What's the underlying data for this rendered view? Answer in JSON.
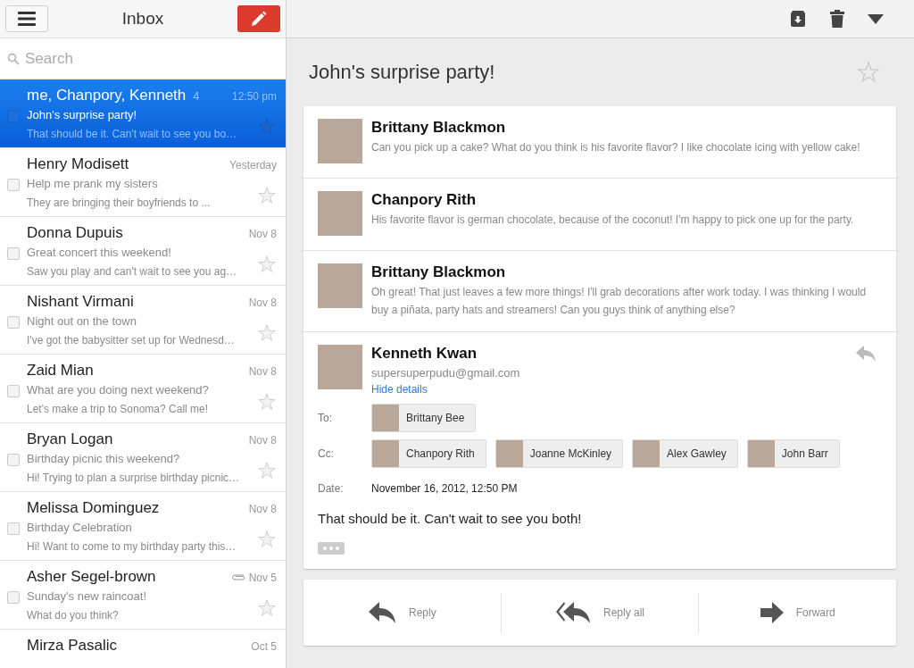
{
  "sidebar": {
    "title": "Inbox",
    "search": {
      "placeholder": "Search"
    },
    "threads": [
      {
        "sender": "me, Chanpory, Kenneth",
        "count": "4",
        "time": "12:50 pm",
        "subject": "John's surprise party!",
        "snippet": "That should be it. Can't wait to see you bo…",
        "selected": true,
        "checked": false,
        "starred": false,
        "attachment": false
      },
      {
        "sender": "Henry Modisett",
        "time": "Yesterday",
        "subject": "Help me prank my sisters",
        "snippet": "They are bringing their boyfriends to ...",
        "selected": false,
        "checked": false,
        "starred": false,
        "attachment": false
      },
      {
        "sender": "Donna Dupuis",
        "time": "Nov 8",
        "subject": "Great concert this weekend!",
        "snippet": "Saw you play and can't wait to see you ag…",
        "selected": false,
        "checked": false,
        "starred": false,
        "attachment": false
      },
      {
        "sender": "Nishant Virmani",
        "time": "Nov 8",
        "subject": "Night out on the town",
        "snippet": "I've got the babysitter set up for Wednesd…",
        "selected": false,
        "checked": false,
        "starred": false,
        "attachment": false
      },
      {
        "sender": "Zaid Mian",
        "time": "Nov 8",
        "subject": "What are you doing next weekend?",
        "snippet": "Let's make a trip to Sonoma? Call me!",
        "selected": false,
        "checked": false,
        "starred": false,
        "attachment": false
      },
      {
        "sender": "Bryan Logan",
        "time": "Nov 8",
        "subject": "Birthday picnic this weekend?",
        "snippet": "Hi! Trying to plan a surprise birthday picnic…",
        "selected": false,
        "checked": false,
        "starred": false,
        "attachment": false
      },
      {
        "sender": "Melissa Dominguez",
        "time": "Nov 8",
        "subject": "Birthday Celebration",
        "snippet": "Hi! Want to come to my birthday party this…",
        "selected": false,
        "checked": false,
        "starred": false,
        "attachment": false
      },
      {
        "sender": "Asher Segel-brown",
        "time": "Nov 5",
        "subject": "Sunday's new raincoat!",
        "snippet": "What do you think?",
        "selected": false,
        "checked": false,
        "starred": false,
        "attachment": true
      },
      {
        "sender": "Mirza Pasalic",
        "time": "Oct 5",
        "selected": false
      }
    ]
  },
  "conversation": {
    "subject": "John's surprise party!",
    "starred": false,
    "messages": [
      {
        "sender": "Brittany Blackmon",
        "snippet": "Can you pick up a cake? What do you think is his favorite flavor? I like chocolate icing with yellow cake!",
        "kind": "collapsed"
      },
      {
        "sender": "Chanpory Rith",
        "snippet": "His favorite flavor is german chocolate, because of the coconut! I'm happy to pick one up for the party.",
        "kind": "collapsed"
      },
      {
        "sender": "Brittany Blackmon",
        "snippet": "Oh great! That just leaves a few more things! I'll grab decorations after work today. I was thinking I would buy a piñata, party hats and streamers! Can you guys think of anything else?",
        "kind": "collapsed"
      },
      {
        "sender": "Kenneth Kwan",
        "email": "supersuperpudu@gmail.com",
        "details_link": "Hide details",
        "kind": "expanded",
        "to_label": "To:",
        "to": [
          "Brittany Bee"
        ],
        "cc_label": "Cc:",
        "cc": [
          "Chanpory Rith",
          "Joanne McKinley",
          "Alex Gawley",
          "John Barr"
        ],
        "date_label": "Date:",
        "date": "November 16, 2012, 12:50 PM",
        "body": "That should be it. Can't wait to see you both!"
      }
    ],
    "actions": [
      {
        "kind": "reply",
        "label": "Reply"
      },
      {
        "kind": "reply_all",
        "label": "Reply all"
      },
      {
        "kind": "forward",
        "label": "Forward"
      }
    ]
  }
}
